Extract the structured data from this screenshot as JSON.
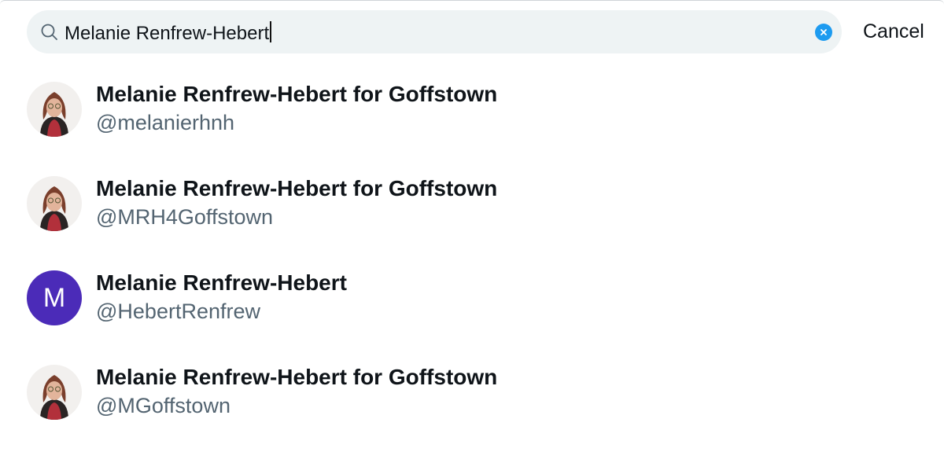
{
  "search": {
    "query": "Melanie Renfrew-Hebert",
    "cancel_label": "Cancel"
  },
  "results": [
    {
      "name": "Melanie Renfrew-Hebert for Goffstown",
      "handle": "@melanierhnh",
      "avatar": "photo"
    },
    {
      "name": "Melanie Renfrew-Hebert for Goffstown",
      "handle": "@MRH4Goffstown",
      "avatar": "photo"
    },
    {
      "name": "Melanie Renfrew-Hebert",
      "handle": "@HebertRenfrew",
      "avatar": "letter",
      "avatar_letter": "M",
      "avatar_color": "#4b2bb8"
    },
    {
      "name": "Melanie Renfrew-Hebert for Goffstown",
      "handle": "@MGoffstown",
      "avatar": "photo"
    }
  ],
  "colors": {
    "search_background": "#eef3f4",
    "accent": "#1d9bf0",
    "secondary_text": "#536471"
  }
}
